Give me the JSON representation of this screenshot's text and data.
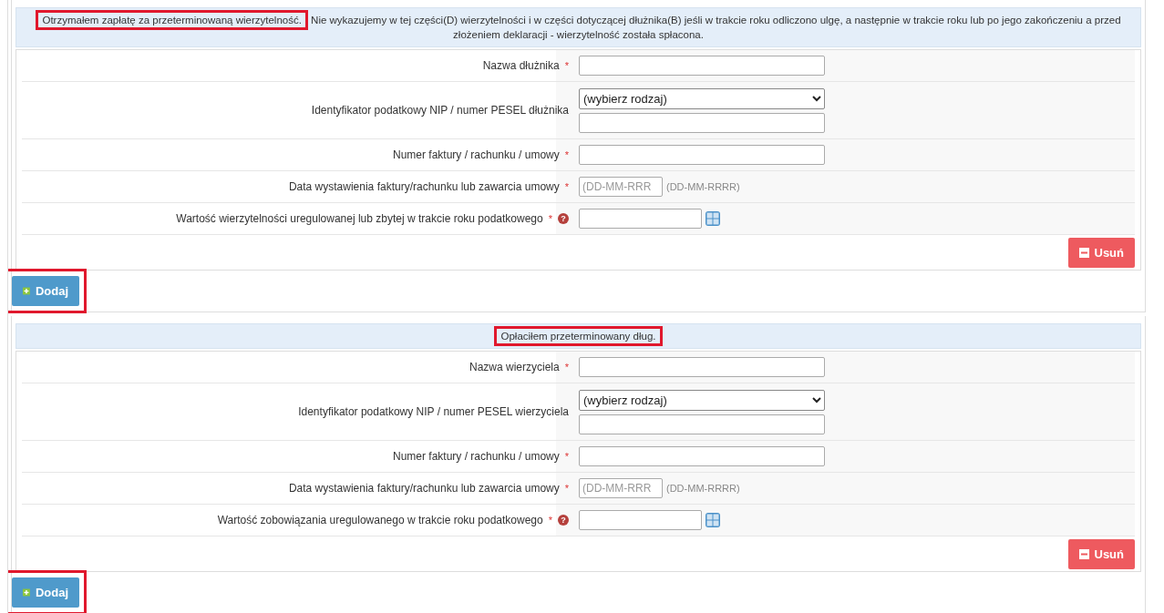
{
  "sections": [
    {
      "header": {
        "title": "Otrzymałem zapłatę za przeterminowaną wierzytelność.",
        "note": "Nie wykazujemy w tej części(D) wierzytelności i w części dotyczącej dłużnika(B) jeśli w trakcie roku odliczono ulgę, a następnie w trakcie roku lub po jego zakończeniu a przed złożeniem deklaracji - wierzytelność została spłacona.",
        "highlighted": true
      },
      "fields": [
        {
          "kind": "text",
          "label": "Nazwa dłużnika",
          "required_mark": "*"
        },
        {
          "kind": "id",
          "label": "Identyfikator podatkowy NIP / numer PESEL dłużnika",
          "select_value": "(wybierz rodzaj)"
        },
        {
          "kind": "text",
          "label": "Numer faktury / rachunku / umowy",
          "required_mark": "*"
        },
        {
          "kind": "date",
          "label": "Data wystawienia faktury/rachunku lub zawarcia umowy",
          "required_mark": "*",
          "placeholder": "(DD-MM-RRR",
          "hint": "(DD-MM-RRRR)"
        },
        {
          "kind": "amount",
          "label": "Wartość wierzytelności uregulowanej lub zbytej w trakcie roku podatkowego",
          "required_mark": "*",
          "help_icon": "?"
        }
      ],
      "remove_button": "Usuń",
      "add_button": {
        "label": "Dodaj",
        "highlighted": true
      }
    },
    {
      "header": {
        "title": "Opłaciłem przeterminowany dług.",
        "highlighted": true
      },
      "fields": [
        {
          "kind": "text",
          "label": "Nazwa wierzyciela",
          "required_mark": "*"
        },
        {
          "kind": "id",
          "label": "Identyfikator podatkowy NIP / numer PESEL wierzyciela",
          "select_value": "(wybierz rodzaj)"
        },
        {
          "kind": "text",
          "label": "Numer faktury / rachunku / umowy",
          "required_mark": "*"
        },
        {
          "kind": "date",
          "label": "Data wystawienia faktury/rachunku lub zawarcia umowy",
          "required_mark": "*",
          "placeholder": "(DD-MM-RRR",
          "hint": "(DD-MM-RRRR)"
        },
        {
          "kind": "amount",
          "label": "Wartość zobowiązania uregulowanego w trakcie roku podatkowego",
          "required_mark": "*",
          "help_icon": "?"
        }
      ],
      "remove_button": "Usuń",
      "add_button": {
        "label": "Dodaj",
        "highlighted": true
      }
    }
  ]
}
